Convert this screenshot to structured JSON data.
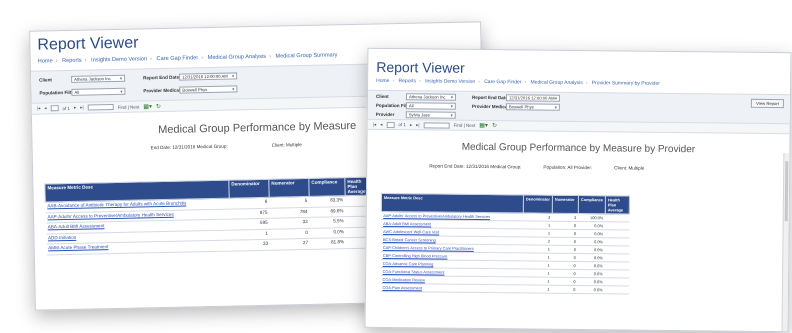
{
  "win1": {
    "title": "Report Viewer",
    "crumbs": [
      "Home",
      "Reports",
      "Insights Demo Version",
      "Care Gap Finder",
      "Medical Group Analysis",
      "Medical Group Summary"
    ],
    "params": {
      "client_label": "Client",
      "client_value": "Athena Jackson Inc",
      "report_end_label": "Report End Date",
      "report_end_value": "12/31/2016 12:00:00 AM",
      "population_label": "Population Filter",
      "population_value": "All",
      "provider_label": "Provider Medical Group",
      "provider_value": "Boswell Phys"
    },
    "toolbar": {
      "page": "of 1",
      "find": "Find | Next"
    },
    "report_title": "Medical Group Performance by Measure",
    "meta": {
      "end_date": "End Date: 12/31/2016 Medical Group:",
      "client": "Client: Multiple"
    },
    "table": {
      "headers": [
        "Measure Metric Desc",
        "Denominator",
        "Numerator",
        "Compliance",
        "Health Plan Average"
      ],
      "rows": [
        [
          "AAB-Avoidance of Antibiotic Therapy for Adults with Acute Bronchitis",
          "6",
          "5",
          "83.3%",
          ""
        ],
        [
          "AAP-Adults' Access to Preventive/Ambulatory Health Services",
          "875",
          "784",
          "89.6%",
          ""
        ],
        [
          "ABA-Adult BMI Assessment",
          "595",
          "33",
          "5.5%",
          ""
        ],
        [
          "ADD-Initiation",
          "1",
          "0",
          "0.0%",
          ""
        ],
        [
          "AMM-Acute Phase Treatment",
          "33",
          "27",
          "81.8%",
          ""
        ]
      ]
    }
  },
  "win2": {
    "title": "Report Viewer",
    "crumbs": [
      "Home",
      "Reports",
      "Insights Demo Version",
      "Care Gap Finder",
      "Medical Group Analysis",
      "Provider Summary by Provider"
    ],
    "params": {
      "client_label": "Client",
      "client_value": "Athena Jackson Inc",
      "report_end_label": "Report End Date",
      "report_end_value": "12/31/2016 12:00:00 AM",
      "population_label": "Population Filter",
      "population_value": "All",
      "provider_label": "Provider Medical Group",
      "provider_value": "Boswell Phys",
      "provider2_label": "Provider",
      "provider2_value": "Sylvia Jass"
    },
    "view_report": "View Report",
    "toolbar": {
      "page": "of 1",
      "find": "Find | Next"
    },
    "report_title": "Medical Group Performance by Measure by Provider",
    "meta": {
      "end_date": "Report End Date: 12/31/2016 Medical Group:",
      "population": "Population: All Provider:",
      "client": "Client: Multiple"
    },
    "table": {
      "headers": [
        "Measure Metric Desc",
        "Denominator",
        "Numerator",
        "Compliance",
        "Health Plan Average"
      ],
      "rows": [
        [
          "AAP-Adults' Access to Preventive/Ambulatory Health Services",
          "3",
          "3",
          "100.0%",
          ""
        ],
        [
          "ABA-Adult BMI Assessment",
          "1",
          "0",
          "0.0%",
          ""
        ],
        [
          "AWC-Adolescent Well-Care Visit",
          "1",
          "0",
          "0.0%",
          ""
        ],
        [
          "BCS-Breast Cancer Screening",
          "2",
          "0",
          "0.0%",
          ""
        ],
        [
          "CAP-Children's Access to Primary Care Practitioners",
          "1",
          "0",
          "0.0%",
          ""
        ],
        [
          "CBP-Controlling High Blood Pressure",
          "1",
          "0",
          "0.0%",
          ""
        ],
        [
          "COA-Advance Care Planning",
          "1",
          "0",
          "0.0%",
          ""
        ],
        [
          "COA-Functional Status Assessment",
          "1",
          "0",
          "0.0%",
          ""
        ],
        [
          "COA-Medication Review",
          "1",
          "0",
          "0.0%",
          ""
        ],
        [
          "COA-Pain Assessment",
          "1",
          "0",
          "0.0%",
          ""
        ]
      ]
    }
  }
}
